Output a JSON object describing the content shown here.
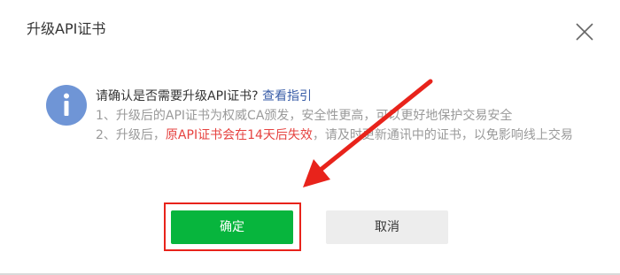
{
  "dialog": {
    "title": "升级API证书",
    "close_icon": "close-icon"
  },
  "notice": {
    "icon": "info-icon",
    "question": "请确认是否需要升级API证书?",
    "guide_link": "查看指引",
    "line1": "1、升级后的API证书为权威CA颁发，安全性更高，可以更好地保护交易安全",
    "line2_prefix": "2、升级后，",
    "line2_highlight": "原API证书会在14天后失效",
    "line2_suffix": "，请及时更新通讯中的证书，以免影响线上交易"
  },
  "buttons": {
    "confirm_label": "确定",
    "cancel_label": "取消"
  },
  "annotation": {
    "arrow_color": "#e8231b",
    "box_color": "#e8231b"
  },
  "colors": {
    "confirm_bg": "#07b53d",
    "info_icon": "#6f95d6",
    "warning_text": "#e64340",
    "link": "#3a5ea8"
  }
}
